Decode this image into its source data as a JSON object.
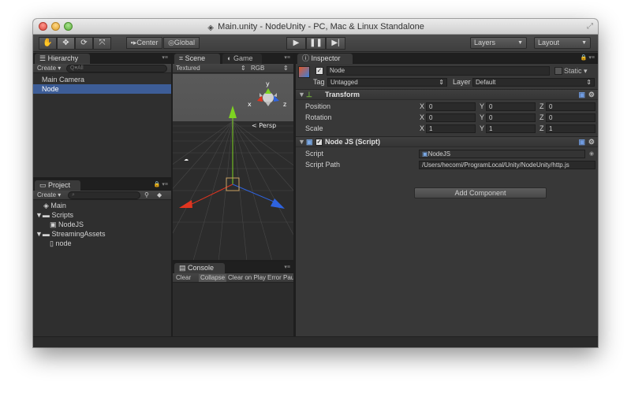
{
  "window": {
    "title": "Main.unity - NodeUnity - PC, Mac & Linux Standalone"
  },
  "toolbar": {
    "tools": [
      "hand-icon",
      "move-icon",
      "rotate-icon",
      "scale-icon"
    ],
    "pivot_label": "Center",
    "space_label": "Global",
    "play_icons": [
      "play-icon",
      "pause-icon",
      "step-icon"
    ],
    "layers_label": "Layers",
    "layout_label": "Layout"
  },
  "hierarchy": {
    "tab_label": "Hierarchy",
    "create_label": "Create",
    "search_placeholder": "Q▾All",
    "items": [
      "Main Camera",
      "Node"
    ],
    "selected": "Node"
  },
  "project": {
    "tab_label": "Project",
    "create_label": "Create",
    "items": [
      {
        "label": "Main",
        "icon": "unity-scene-icon",
        "indent": 0
      },
      {
        "label": "Scripts",
        "icon": "folder-icon",
        "indent": 0,
        "expanded": true
      },
      {
        "label": "NodeJS",
        "icon": "script-icon",
        "indent": 1
      },
      {
        "label": "StreamingAssets",
        "icon": "folder-icon",
        "indent": 0,
        "expanded": true
      },
      {
        "label": "node",
        "icon": "file-icon",
        "indent": 1
      }
    ]
  },
  "scene": {
    "tab_scene": "Scene",
    "tab_game": "Game",
    "render_mode": "Textured",
    "channel": "RGB",
    "persp_label": "< Persp",
    "gizmo_y": "y",
    "gizmo_x": "x",
    "gizmo_z": "z"
  },
  "console": {
    "tab_label": "Console",
    "buttons": [
      "Clear",
      "Collapse",
      "Clear on Play",
      "Error Pau"
    ]
  },
  "inspector": {
    "tab_label": "Inspector",
    "object_name": "Node",
    "static_label": "Static",
    "tag_label": "Tag",
    "tag_value": "Untagged",
    "layer_label": "Layer",
    "layer_value": "Default",
    "transform": {
      "title": "Transform",
      "rows": [
        {
          "label": "Position",
          "x": "0",
          "y": "0",
          "z": "0"
        },
        {
          "label": "Rotation",
          "x": "0",
          "y": "0",
          "z": "0"
        },
        {
          "label": "Scale",
          "x": "1",
          "y": "1",
          "z": "1"
        }
      ]
    },
    "script_component": {
      "title": "Node JS (Script)",
      "script_label": "Script",
      "script_value": "NodeJS",
      "path_label": "Script Path",
      "path_value": "/Users/hecomi/ProgramLocal/Unity/NodeUnity/http.js"
    },
    "add_component_label": "Add Component"
  },
  "colors": {
    "selection": "#3d5d97",
    "panel_bg": "#2f2f2f",
    "gizmo_y": "#7ed321",
    "gizmo_x": "#e0341f",
    "gizmo_z": "#2e63e0"
  }
}
